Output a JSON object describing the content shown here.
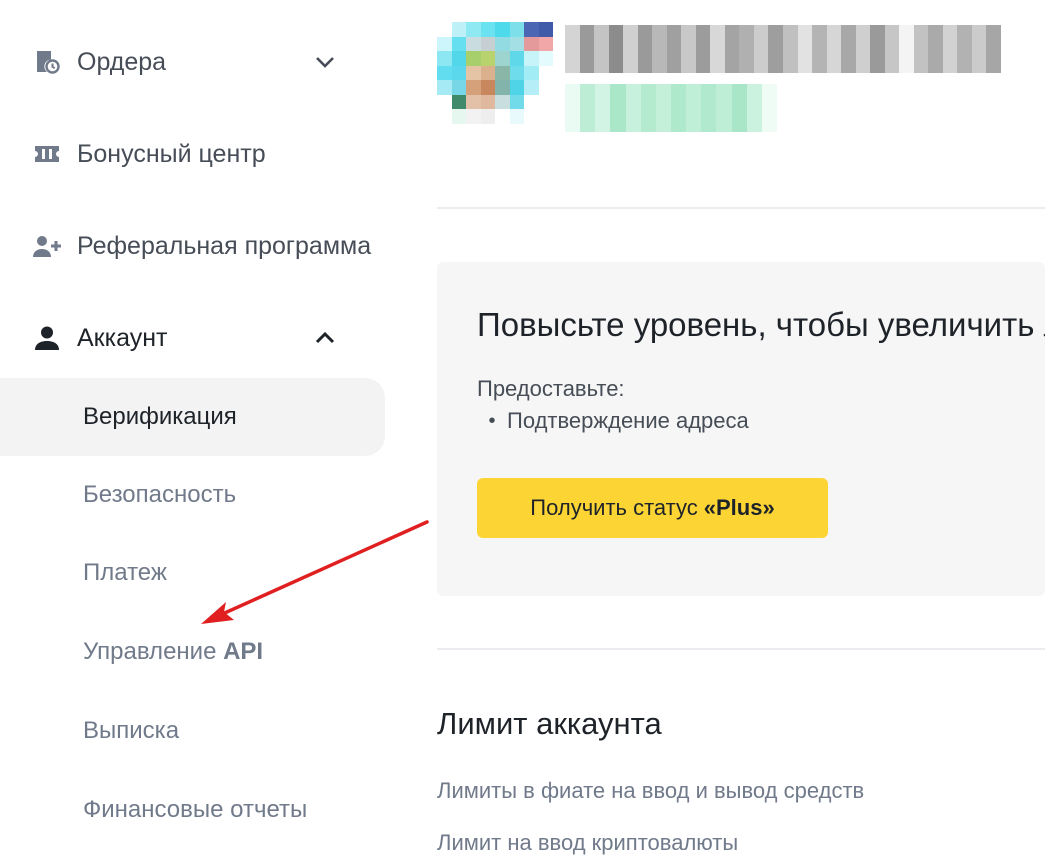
{
  "sidebar": {
    "items": [
      {
        "label": "Ордера",
        "icon": "orders-clock-icon",
        "chevron": "chevron-down-icon"
      },
      {
        "label": "Бонусный центр",
        "icon": "ticket-icon"
      },
      {
        "label": "Реферальная программа",
        "icon": "add-user-icon"
      },
      {
        "label": "Аккаунт",
        "icon": "user-icon",
        "chevron": "chevron-up-icon"
      }
    ],
    "account_subitems": [
      {
        "label": "Верификация",
        "active": true
      },
      {
        "label": "Безопасность"
      },
      {
        "label": "Платеж"
      },
      {
        "label_prefix": "Управление ",
        "label_strong": "API"
      },
      {
        "label": "Выписка"
      },
      {
        "label": "Финансовые отчеты"
      }
    ]
  },
  "profile": {
    "avatar": "pixelated-avatar",
    "uid": "",
    "email": ""
  },
  "upgrade": {
    "title": "Повысьте уровень, чтобы увеличить л",
    "provide_label": "Предоставьте:",
    "requirements": [
      "Подтверждение адреса"
    ],
    "button_prefix": "Получить статус",
    "button_strong": "«Plus»"
  },
  "limits": {
    "title": "Лимит аккаунта",
    "links": [
      "Лимиты в фиате на ввод и вывод средств",
      "Лимит на ввод криптовалюты"
    ]
  },
  "annotation": {
    "type": "red-arrow",
    "color": "#e02020",
    "points_to": "Управление API"
  },
  "colors": {
    "accent_yellow": "#fcd535",
    "text_primary": "#1e2329",
    "text_secondary": "#707a8a",
    "active_bg": "#f3f3f3"
  }
}
